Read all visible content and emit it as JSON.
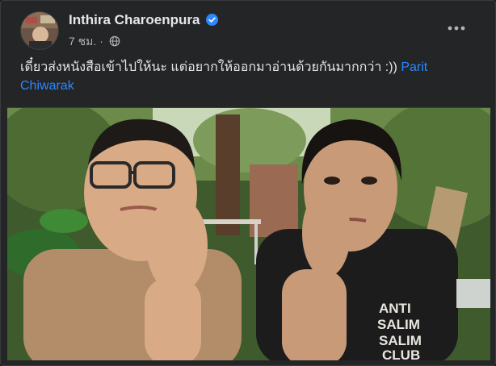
{
  "post": {
    "author": "Inthira Charoenpura",
    "timestamp": "7 ชม.",
    "separator": "·",
    "audience_icon": "globe-icon",
    "verified_icon": "verified-badge-icon",
    "more_icon": "more-options-icon",
    "text": "เดี๋ยวส่งหนังสือเข้าไปให้นะ แต่อยากให้ออกมาอ่านด้วยกันมากกว่า :)) ",
    "mention": "Parit Chiwarak",
    "photo": {
      "shirt_text": [
        "ANTI",
        "SALIM",
        "SALIM",
        "CLUB"
      ]
    }
  },
  "colors": {
    "background": "#242526",
    "text": "#e4e6eb",
    "secondary_text": "#b0b3b8",
    "link": "#2d88ff",
    "verified": "#2d88ff"
  }
}
